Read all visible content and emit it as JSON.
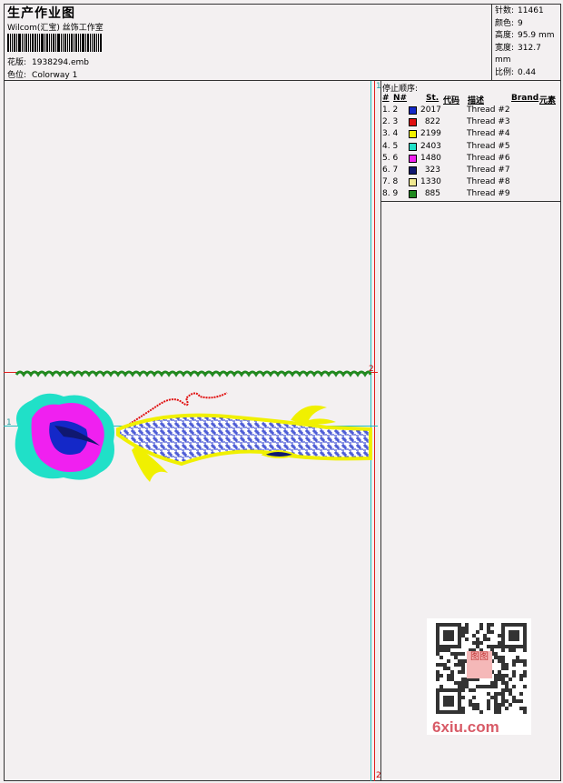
{
  "header": {
    "title": "生产作业图",
    "subtitle": "Wilcom(汇宝) 丝饰工作室",
    "design_label": "花版:",
    "design_value": "1938294.emb",
    "colorway_label": "色位:",
    "colorway_value": "Colorway 1"
  },
  "stats": [
    {
      "label": "针数:",
      "value": "11461"
    },
    {
      "label": "颜色:",
      "value": "9"
    },
    {
      "label": "高度:",
      "value": "95.9 mm"
    },
    {
      "label": "宽度:",
      "value": "312.7 mm"
    },
    {
      "label": "比例:",
      "value": "0.44"
    }
  ],
  "sequence": {
    "title": "停止顺序:",
    "headers": {
      "num": "#",
      "n": "N#",
      "st": "St.",
      "code": "代码",
      "desc": "描述",
      "brand": "Brand",
      "element": "元素"
    },
    "rows": [
      {
        "no": "1. 2",
        "color": "#1428c8",
        "st": "2017",
        "desc": "Thread #2"
      },
      {
        "no": "2. 3",
        "color": "#e01010",
        "st": "822",
        "desc": "Thread #3"
      },
      {
        "no": "3. 4",
        "color": "#f0f000",
        "st": "2199",
        "desc": "Thread #4"
      },
      {
        "no": "4. 5",
        "color": "#20e0c8",
        "st": "2403",
        "desc": "Thread #5"
      },
      {
        "no": "5. 6",
        "color": "#f020f0",
        "st": "1480",
        "desc": "Thread #6"
      },
      {
        "no": "6. 7",
        "color": "#101870",
        "st": "323",
        "desc": "Thread #7"
      },
      {
        "no": "7. 8",
        "color": "#f0e890",
        "st": "1330",
        "desc": "Thread #8"
      },
      {
        "no": "8. 9",
        "color": "#208a20",
        "st": "885",
        "desc": "Thread #9"
      }
    ]
  },
  "rulers": {
    "marker_1": "1",
    "marker_2": "2"
  },
  "watermark": {
    "text": "6xiu.com",
    "stamp": "图图"
  }
}
